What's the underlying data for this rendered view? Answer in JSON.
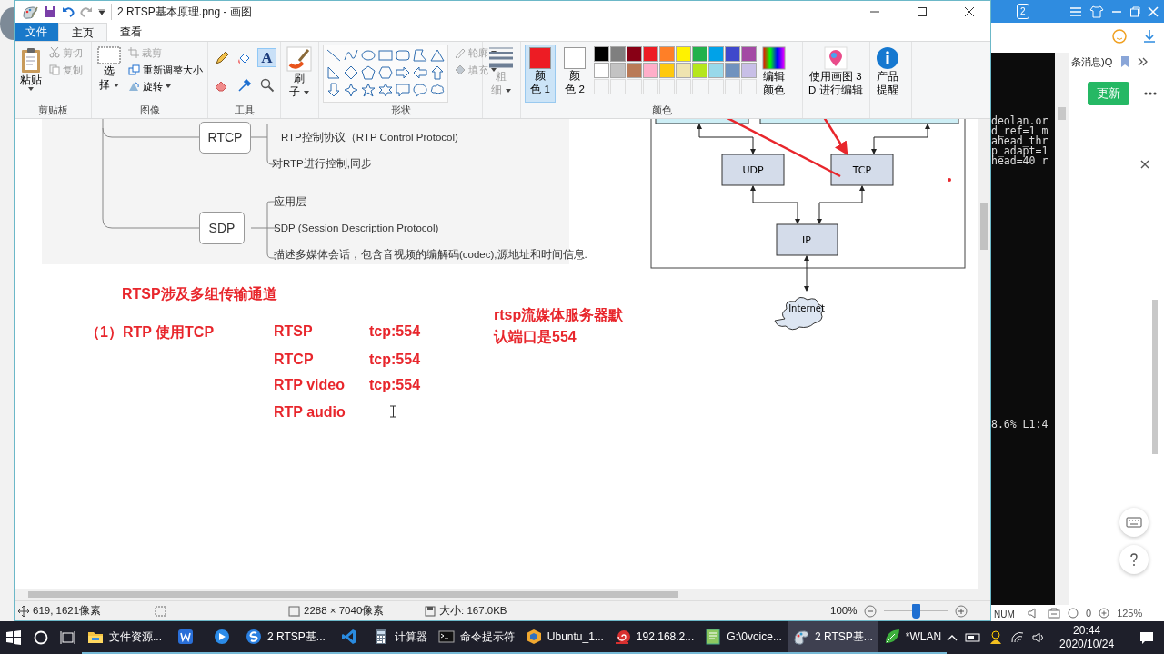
{
  "window": {
    "title": "2 RTSP基本原理.png - 画图"
  },
  "ribbon_tabs": [
    {
      "label": "文件",
      "kind": "file",
      "selected": false
    },
    {
      "label": "主页",
      "kind": "tab",
      "selected": true
    },
    {
      "label": "查看",
      "kind": "tab",
      "selected": false
    }
  ],
  "clipboard": {
    "label": "剪贴板",
    "paste": "粘贴",
    "cut": {
      "label": "剪切",
      "disabled": true
    },
    "copy": {
      "label": "复制",
      "disabled": true
    }
  },
  "image": {
    "label": "图像",
    "select": [
      "选",
      "择"
    ],
    "crop": {
      "label": "裁剪",
      "disabled": true
    },
    "resize": {
      "label": "重新调整大小",
      "disabled": false
    },
    "rotate": {
      "label": "旋转",
      "disabled": false
    }
  },
  "tools": {
    "label": "工具",
    "items": [
      {
        "kind": "pencil",
        "selected": false
      },
      {
        "kind": "fill",
        "selected": false
      },
      {
        "kind": "text",
        "glyph": "A",
        "selected": true
      },
      {
        "kind": "eraser",
        "selected": false
      },
      {
        "kind": "picker",
        "selected": false
      },
      {
        "kind": "magnifier",
        "selected": false
      }
    ]
  },
  "brushes": {
    "label": [
      "刷",
      "子"
    ]
  },
  "shapes": {
    "label": "形状",
    "outline": {
      "label": "轮廓",
      "disabled": true
    },
    "fill": {
      "label": "填充",
      "disabled": true
    }
  },
  "size": {
    "label": [
      "粗",
      "细"
    ],
    "disabled": true
  },
  "colors": {
    "label": "颜色",
    "color1": {
      "label": [
        "颜",
        "色 1"
      ],
      "color": "#ed1c24",
      "selected": true
    },
    "color2": {
      "label": [
        "颜",
        "色 2"
      ],
      "color": "#ffffff",
      "selected": false
    },
    "palette": [
      {
        "color": "#000000"
      },
      {
        "color": "#7f7f7f"
      },
      {
        "color": "#880015"
      },
      {
        "color": "#ed1c24"
      },
      {
        "color": "#ff7f27"
      },
      {
        "color": "#fff200"
      },
      {
        "color": "#22b14c"
      },
      {
        "color": "#00a2e8"
      },
      {
        "color": "#3f48cc"
      },
      {
        "color": "#a349a4"
      },
      {
        "color": "#ffffff"
      },
      {
        "color": "#c3c3c3"
      },
      {
        "color": "#b97a57"
      },
      {
        "color": "#ffaec9"
      },
      {
        "color": "#ffc90e"
      },
      {
        "color": "#efe4b0"
      },
      {
        "color": "#b5e61d"
      },
      {
        "color": "#99d9ea"
      },
      {
        "color": "#7092be"
      },
      {
        "color": "#c8bfe7"
      },
      {
        "kind": "empty"
      },
      {
        "kind": "empty"
      },
      {
        "kind": "empty"
      },
      {
        "kind": "empty"
      },
      {
        "kind": "empty"
      },
      {
        "kind": "empty"
      },
      {
        "kind": "empty"
      },
      {
        "kind": "empty"
      },
      {
        "kind": "empty"
      },
      {
        "kind": "empty"
      }
    ],
    "edit": [
      "编辑",
      "颜色"
    ]
  },
  "paint3d": [
    "使用画图 3",
    "D 进行编辑"
  ],
  "product_alert": [
    "产品",
    "提醒"
  ],
  "canvas": {
    "mindmap": [
      {
        "label": "RTCP",
        "items": [
          "RTP控制协议（RTP Control Protocol)",
          "对RTP进行控制,同步"
        ]
      },
      {
        "label": "SDP",
        "items": [
          "应用层",
          "SDP (Session Description Protocol)",
          "描述多媒体会话，包含音视频的编解码(codec),源地址和时间信息."
        ]
      }
    ],
    "diagram": {
      "udp": "UDP",
      "tcp": "TCP",
      "ip": "IP",
      "internet": "Internet"
    },
    "title": "RTSP涉及多组传输通道",
    "case": "（1）RTP 使用TCP",
    "channels": [
      {
        "name": "RTSP",
        "port": "tcp:554"
      },
      {
        "name": "RTCP",
        "port": "tcp:554"
      },
      {
        "name": "RTP video",
        "port": "tcp:554"
      },
      {
        "name": "RTP audio"
      }
    ],
    "note": "rtsp流媒体服务器默认端口是554"
  },
  "status_bar": {
    "cursor": "619, 1621像素",
    "image_size": "2288 × 7040像素",
    "file_size": "大小: 167.0KB",
    "zoom": "100%",
    "zoom_slider": {
      "level": 0.5
    }
  },
  "terminal": {
    "lines": [
      "deolan.or",
      "d_ref=1 m",
      "ahead_thr",
      "p_adapt=1",
      "head=40 r"
    ],
    "status_line": "8.6% L1:4"
  },
  "num_indicator": "NUM",
  "browser": {
    "tab_count": "2",
    "bookmark": "条消息)Q",
    "update_button": "更新",
    "status_count": "0",
    "status_zoom": "125%"
  },
  "taskbar": {
    "items": [
      {
        "kind": "folder",
        "label": "文件资源...",
        "selected": false
      },
      {
        "kind": "doc",
        "selected": false
      },
      {
        "kind": "globe",
        "selected": false
      },
      {
        "kind": "sapp",
        "label": "2 RTSP基...",
        "selected": false
      },
      {
        "kind": "code",
        "selected": false
      },
      {
        "kind": "calc",
        "label": "计算器",
        "selected": false
      },
      {
        "kind": "console",
        "label": "命令提示符",
        "selected": false
      },
      {
        "kind": "box",
        "label": "Ubuntu_1...",
        "selected": false
      },
      {
        "kind": "spiral",
        "label": "192.168.2...",
        "selected": false
      },
      {
        "kind": "editor",
        "label": "G:\\0voice...",
        "selected": false
      },
      {
        "kind": "palette",
        "label": "2 RTSP基...",
        "selected": true
      },
      {
        "kind": "leaf",
        "label": "*WLAN",
        "selected": false
      }
    ],
    "time": "20:44",
    "date": "2020/10/24"
  }
}
